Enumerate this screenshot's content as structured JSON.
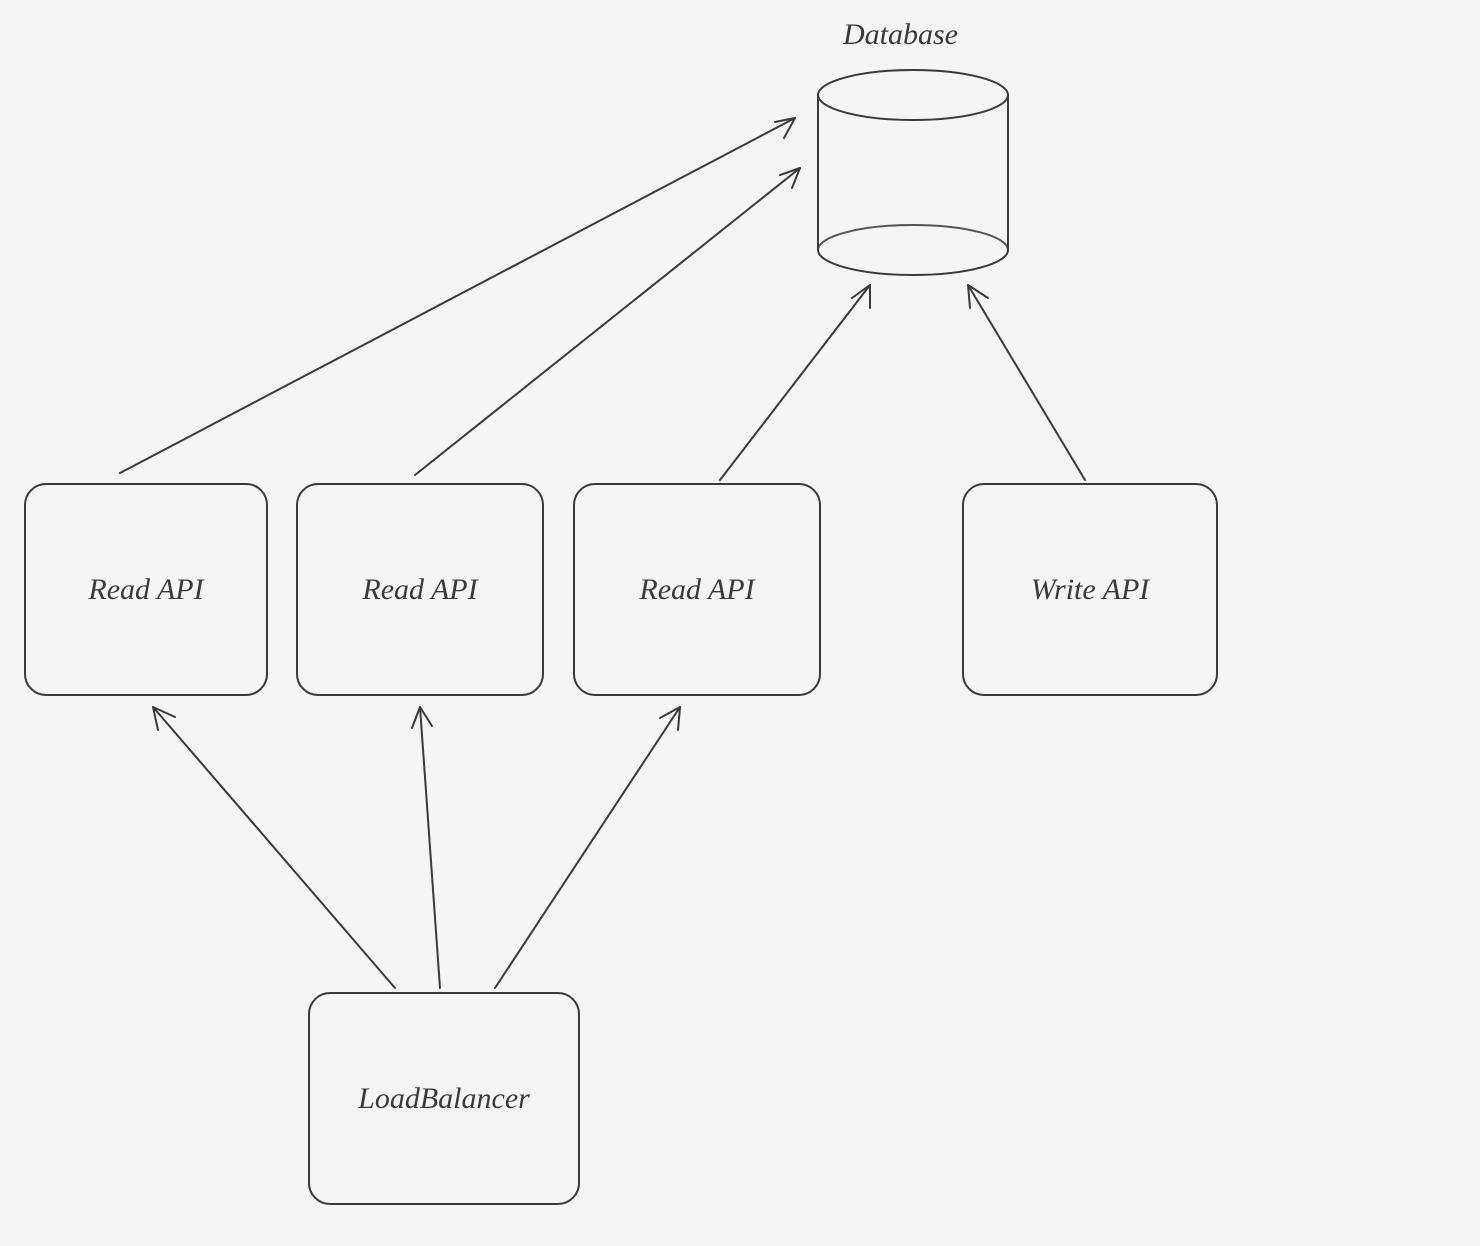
{
  "diagram": {
    "title": "Database",
    "nodes": {
      "database": {
        "label": "Database"
      },
      "read_api_1": {
        "label": "Read API"
      },
      "read_api_2": {
        "label": "Read API"
      },
      "read_api_3": {
        "label": "Read API"
      },
      "write_api": {
        "label": "Write API"
      },
      "load_balancer": {
        "label": "LoadBalancer"
      }
    },
    "edges": [
      {
        "from": "read_api_1",
        "to": "database"
      },
      {
        "from": "read_api_2",
        "to": "database"
      },
      {
        "from": "read_api_3",
        "to": "database"
      },
      {
        "from": "write_api",
        "to": "database"
      },
      {
        "from": "load_balancer",
        "to": "read_api_1"
      },
      {
        "from": "load_balancer",
        "to": "read_api_2"
      },
      {
        "from": "load_balancer",
        "to": "read_api_3"
      }
    ]
  }
}
